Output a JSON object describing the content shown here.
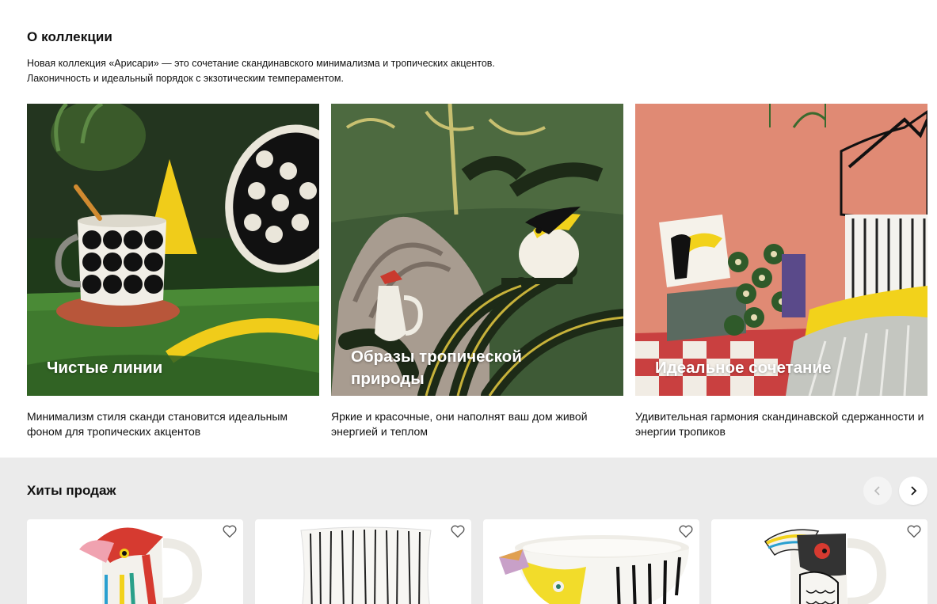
{
  "about": {
    "title": "О коллекции",
    "desc_line1": "Новая коллекция «Арисари» — это сочетание скандинавского минимализма и тропических акцентов.",
    "desc_line2": "Лаконичность и идеальный порядок с экзотическим темпераментом."
  },
  "cards": [
    {
      "caption": "Чистые линии",
      "text": "Минимализм стиля сканди становится идеальным фоном для тропических акцентов"
    },
    {
      "caption_line1": "Образы тропической",
      "caption_line2": "природы",
      "text": "Яркие и красочные, они наполнят ваш дом живой энергией и теплом"
    },
    {
      "caption": "Идеальное сочетание",
      "text": "Удивительная гармония скандинавской сдержанности и энергии тропиков"
    }
  ],
  "hits": {
    "title": "Хиты продаж",
    "prev_icon": "chevron-left-icon",
    "next_icon": "chevron-right-icon",
    "products": [
      {
        "name": "toucan-pitcher",
        "fav_icon": "heart-icon"
      },
      {
        "name": "striped-cushion",
        "fav_icon": "heart-icon"
      },
      {
        "name": "toucan-bowl",
        "fav_icon": "heart-icon"
      },
      {
        "name": "hornbill-pitcher",
        "fav_icon": "heart-icon"
      }
    ]
  },
  "colors": {
    "accent_yellow": "#f2d21b",
    "green_bg": "#3e6a2c",
    "salmon_bg": "#e08a74",
    "hits_bg": "#ebebeb"
  }
}
